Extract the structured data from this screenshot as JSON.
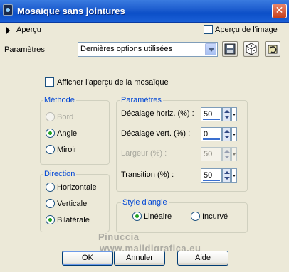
{
  "window": {
    "title": "Mosaïque sans jointures",
    "close_glyph": "✕"
  },
  "preview": {
    "toggle_label": "Aperçu",
    "preview_checkbox_label": "Aperçu de l'image",
    "preview_checked": false
  },
  "presets": {
    "label": "Paramètres",
    "selected": "Dernières options utilisées"
  },
  "toolbar": {
    "icons": [
      "save-icon",
      "randomize-icon",
      "reset-icon"
    ]
  },
  "mosaic_preview": {
    "label": "Afficher l'aperçu de la mosaïque",
    "checked": false
  },
  "methode": {
    "title": "Méthode",
    "options": [
      {
        "label": "Bord",
        "checked": false,
        "disabled": true
      },
      {
        "label": "Angle",
        "checked": true,
        "disabled": false
      },
      {
        "label": "Miroir",
        "checked": false,
        "disabled": false
      }
    ]
  },
  "direction": {
    "title": "Direction",
    "options": [
      {
        "label": "Horizontale",
        "checked": false
      },
      {
        "label": "Verticale",
        "checked": false
      },
      {
        "label": "Bilatérale",
        "checked": true
      }
    ]
  },
  "parametres": {
    "title": "Paramètres",
    "fields": [
      {
        "label": "Décalage horiz. (%) :",
        "value": "50",
        "disabled": false
      },
      {
        "label": "Décalage vert. (%) :",
        "value": "0",
        "disabled": false
      },
      {
        "label": "Largeur (%) :",
        "value": "50",
        "disabled": true
      },
      {
        "label": "Transition (%) :",
        "value": "50",
        "disabled": false
      }
    ]
  },
  "style_angle": {
    "title": "Style d'angle",
    "options": [
      {
        "label": "Linéaire",
        "checked": true
      },
      {
        "label": "Incurvé",
        "checked": false
      }
    ]
  },
  "watermark": {
    "line1": "Pinuccia",
    "line2": "www.maildigrafica.eu"
  },
  "buttons": {
    "ok": "OK",
    "cancel": "Annuler",
    "help": "Aide"
  },
  "colors": {
    "titlebar": "#0c4fc8",
    "group_title": "#0046d5",
    "radio_dot": "#21a121"
  }
}
